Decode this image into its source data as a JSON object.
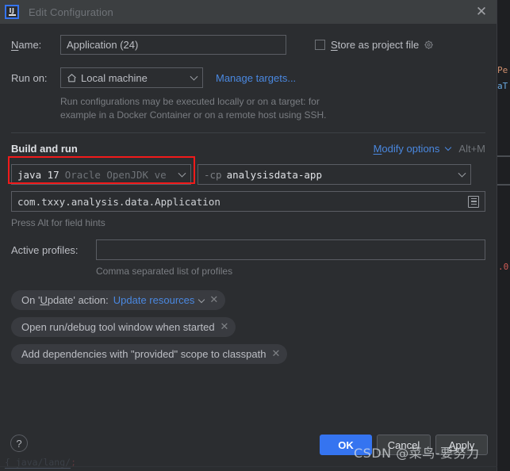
{
  "window": {
    "title": "Edit Configuration",
    "app_icon": "intellij-idea-icon",
    "close_label": "✕"
  },
  "form": {
    "name_label": "Name:",
    "name_label_mnemonic": "N",
    "name_value": "Application (24)",
    "store_as_project_file_label": "Store as project file",
    "store_as_project_file_mnemonic": "S",
    "store_as_project_file_checked": false,
    "run_on_label": "Run on:",
    "run_on_value": "Local machine",
    "run_on_icon": "home-icon",
    "manage_targets_link": "Manage targets...",
    "run_on_hint_line1": "Run configurations may be executed locally or on a target: for",
    "run_on_hint_line2": "example in a Docker Container or on a remote host using SSH."
  },
  "build_and_run": {
    "section_title": "Build and run",
    "modify_options_label": "Modify options",
    "modify_options_mnemonic": "M",
    "modify_options_shortcut": "Alt+M",
    "jdk_primary": "java 17",
    "jdk_secondary": "Oracle OpenJDK ve",
    "classpath_prefix": "-cp",
    "classpath_module": "analysisdata-app",
    "main_class_value": "com.txxy.analysis.data.Application",
    "main_class_icon": "document-list-icon",
    "field_hint": "Press Alt for field hints",
    "active_profiles_label": "Active profiles:",
    "active_profiles_value": "",
    "active_profiles_hint": "Comma separated list of profiles"
  },
  "option_chips": [
    {
      "label": "On 'Update' action:",
      "mnemonic": "U",
      "value": "Update resources",
      "has_dropdown": true,
      "close_label": "✕"
    },
    {
      "label": "Open run/debug tool window when started",
      "value": "",
      "has_dropdown": false,
      "close_label": "✕"
    },
    {
      "label": "Add dependencies with \"provided\" scope to classpath",
      "value": "",
      "has_dropdown": false,
      "close_label": "✕"
    }
  ],
  "footer": {
    "help_label": "?",
    "ok_label": "OK",
    "cancel_label": "Cancel",
    "apply_label": "Apply",
    "apply_mnemonic": "A"
  },
  "watermark": "CSDN @菜鸟-要努力",
  "background": {
    "peek_text_1": "Pe",
    "peek_text_2": "aT",
    "peek_red": ".0",
    "peek_bottom_text": "{ java/lang/"
  },
  "colors": {
    "accent": "#3574f0",
    "link": "#4a88e0",
    "highlight_box": "#f11a1a",
    "dialog_bg": "#2b2d30",
    "titlebar_bg": "#3c3f41",
    "text": "#bcbec4"
  }
}
